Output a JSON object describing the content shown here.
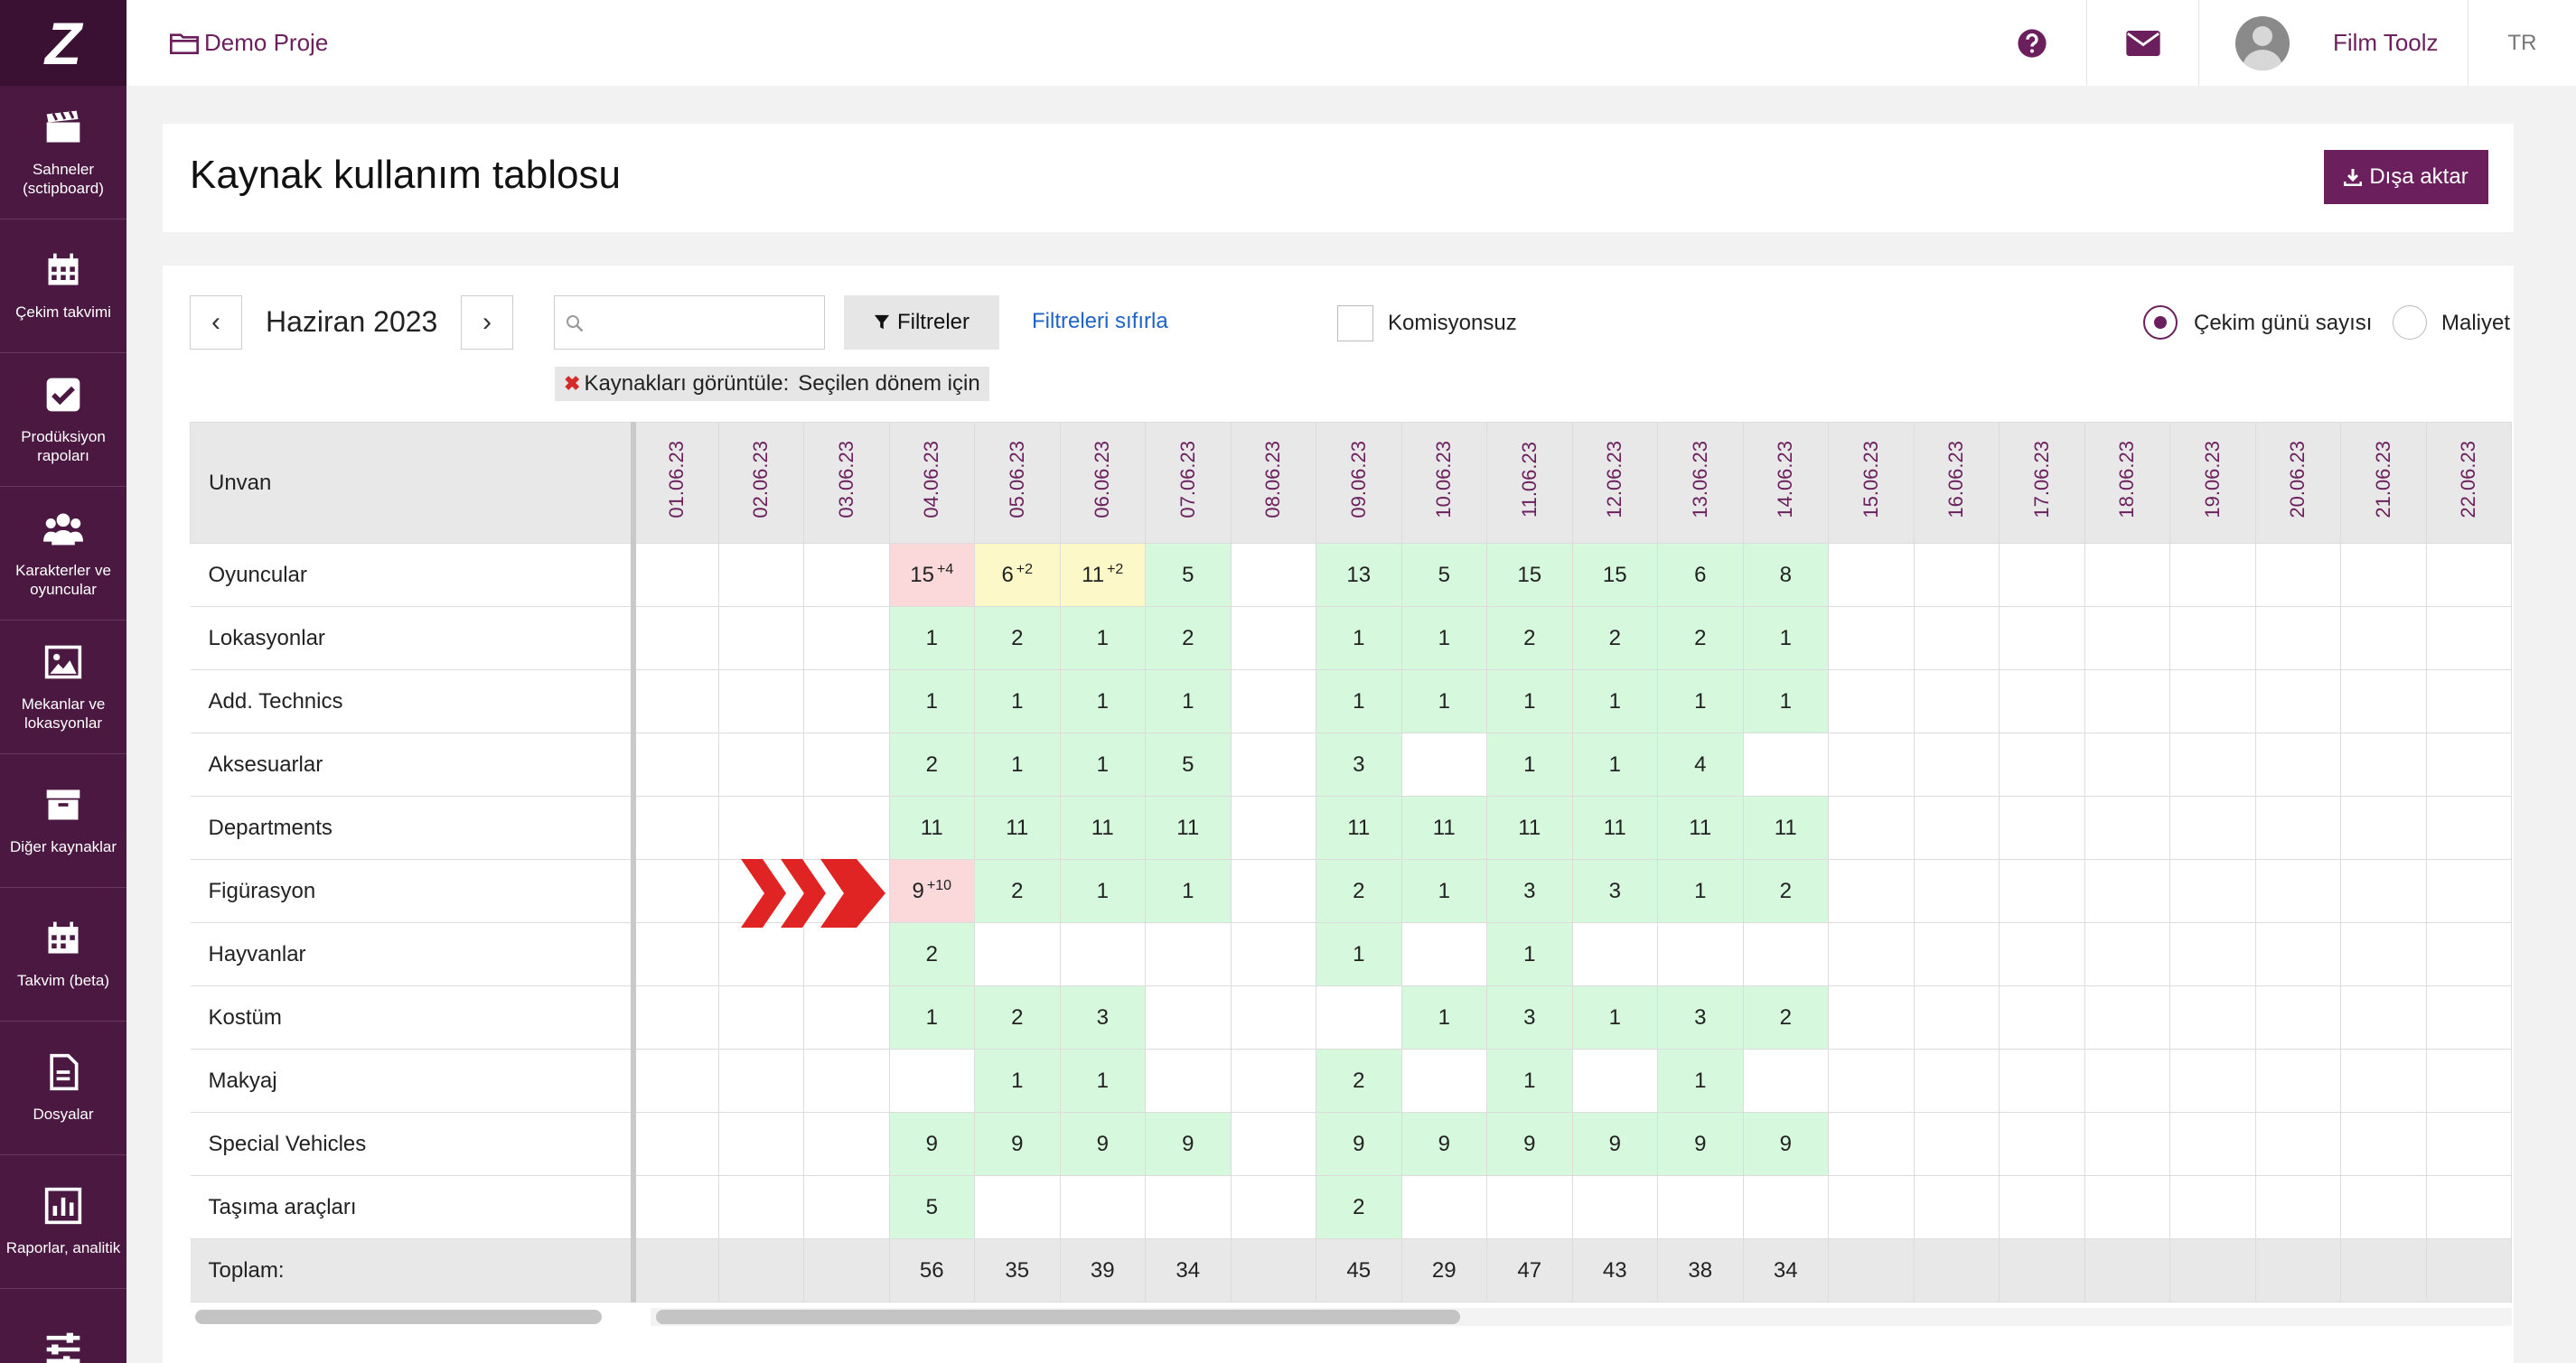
{
  "app": {
    "logo": "Z",
    "project_name": "Demo Proje",
    "user_name": "Film Toolz",
    "language": "TR"
  },
  "sidebar": {
    "items": [
      {
        "label": "Sahneler (sctipboard)",
        "icon": "clapperboard-icon"
      },
      {
        "label": "Çekim takvimi",
        "icon": "calendar-icon"
      },
      {
        "label": "Prodüksiyon rapoları",
        "icon": "check-square-icon"
      },
      {
        "label": "Karakterler ve oyuncular",
        "icon": "users-icon"
      },
      {
        "label": "Mekanlar ve lokasyonlar",
        "icon": "image-icon"
      },
      {
        "label": "Diğer kaynaklar",
        "icon": "archive-icon"
      },
      {
        "label": "Takvim (beta)",
        "icon": "calendar-beta-icon"
      },
      {
        "label": "Dosyalar",
        "icon": "file-icon"
      },
      {
        "label": "Raporlar, analitik",
        "icon": "bar-chart-icon"
      },
      {
        "label": "",
        "icon": "sliders-icon"
      }
    ]
  },
  "header": {
    "title": "Kaynak kullanım tablosu",
    "export_label": "Dışa aktar"
  },
  "controls": {
    "prev": "‹",
    "next": "›",
    "month": "Haziran 2023",
    "search_value": "",
    "filter_label": "Filtreler",
    "reset_label": "Filtreleri sıfırla",
    "checkbox_label": "Komisyonsuz",
    "checkbox_checked": false,
    "radio_options": [
      {
        "label": "Çekim günü sayısı",
        "selected": true
      },
      {
        "label": "Maliyet",
        "selected": false
      }
    ],
    "chip_prefix": "Kaynakları görüntüle:",
    "chip_value": "Seçilen dönem için"
  },
  "colors": {
    "brand": "#4a1840",
    "accent": "#6b1f5c",
    "link": "#1e63c7",
    "cell_green": "#d6f8dd",
    "cell_pink": "#fbd8da",
    "cell_yellow": "#fdf8c8",
    "marker_red": "#e02424"
  },
  "table": {
    "label_header": "Unvan",
    "dates": [
      "01.06.23",
      "02.06.23",
      "03.06.23",
      "04.06.23",
      "05.06.23",
      "06.06.23",
      "07.06.23",
      "08.06.23",
      "09.06.23",
      "10.06.23",
      "11.06.23",
      "12.06.23",
      "13.06.23",
      "14.06.23",
      "15.06.23",
      "16.06.23",
      "17.06.23",
      "18.06.23",
      "19.06.23",
      "20.06.23",
      "21.06.23",
      "22.06.23"
    ],
    "rows": [
      {
        "label": "Oyuncular",
        "cells": [
          "",
          "",
          "",
          "15",
          "6",
          "11",
          "5",
          "",
          "13",
          "5",
          "15",
          "15",
          "6",
          "8",
          "",
          "",
          "",
          "",
          "",
          "",
          "",
          ""
        ],
        "sup": {
          "3": "+4",
          "4": "+2",
          "5": "+2"
        },
        "color": {
          "3": "pink",
          "4": "yellow",
          "5": "yellow"
        }
      },
      {
        "label": "Lokasyonlar",
        "cells": [
          "",
          "",
          "",
          "1",
          "2",
          "1",
          "2",
          "",
          "1",
          "1",
          "2",
          "2",
          "2",
          "1",
          "",
          "",
          "",
          "",
          "",
          "",
          "",
          ""
        ]
      },
      {
        "label": "Add. Technics",
        "cells": [
          "",
          "",
          "",
          "1",
          "1",
          "1",
          "1",
          "",
          "1",
          "1",
          "1",
          "1",
          "1",
          "1",
          "",
          "",
          "",
          "",
          "",
          "",
          "",
          ""
        ]
      },
      {
        "label": "Aksesuarlar",
        "cells": [
          "",
          "",
          "",
          "2",
          "1",
          "1",
          "5",
          "",
          "3",
          "",
          "1",
          "1",
          "4",
          "",
          "",
          "",
          "",
          "",
          "",
          "",
          "",
          ""
        ]
      },
      {
        "label": "Departments",
        "cells": [
          "",
          "",
          "",
          "11",
          "11",
          "11",
          "11",
          "",
          "11",
          "11",
          "11",
          "11",
          "11",
          "11",
          "",
          "",
          "",
          "",
          "",
          "",
          "",
          ""
        ]
      },
      {
        "label": "Figürasyon",
        "cells": [
          "",
          "",
          "",
          "9",
          "2",
          "1",
          "1",
          "",
          "2",
          "1",
          "3",
          "3",
          "1",
          "2",
          "",
          "",
          "",
          "",
          "",
          "",
          "",
          ""
        ],
        "sup": {
          "3": "+10"
        },
        "color": {
          "3": "pink"
        }
      },
      {
        "label": "Hayvanlar",
        "cells": [
          "",
          "",
          "",
          "2",
          "",
          "",
          "",
          "",
          "1",
          "",
          "1",
          "",
          "",
          "",
          "",
          "",
          "",
          "",
          "",
          "",
          "",
          ""
        ]
      },
      {
        "label": "Kostüm",
        "cells": [
          "",
          "",
          "",
          "1",
          "2",
          "3",
          "",
          "",
          "",
          "1",
          "3",
          "1",
          "3",
          "2",
          "",
          "",
          "",
          "",
          "",
          "",
          "",
          ""
        ]
      },
      {
        "label": "Makyaj",
        "cells": [
          "",
          "",
          "",
          "",
          "1",
          "1",
          "",
          "",
          "2",
          "",
          "1",
          "",
          "1",
          "",
          "",
          "",
          "",
          "",
          "",
          "",
          "",
          ""
        ]
      },
      {
        "label": "Special Vehicles",
        "cells": [
          "",
          "",
          "",
          "9",
          "9",
          "9",
          "9",
          "",
          "9",
          "9",
          "9",
          "9",
          "9",
          "9",
          "",
          "",
          "",
          "",
          "",
          "",
          "",
          ""
        ]
      },
      {
        "label": "Taşıma araçları",
        "cells": [
          "",
          "",
          "",
          "5",
          "",
          "",
          "",
          "",
          "2",
          "",
          "",
          "",
          "",
          "",
          "",
          "",
          "",
          "",
          "",
          "",
          "",
          ""
        ]
      }
    ],
    "total": {
      "label": "Toplam:",
      "cells": [
        "",
        "",
        "",
        "56",
        "35",
        "39",
        "34",
        "",
        "45",
        "29",
        "47",
        "43",
        "38",
        "34",
        "",
        "",
        "",
        "",
        "",
        "",
        "",
        ""
      ]
    }
  }
}
